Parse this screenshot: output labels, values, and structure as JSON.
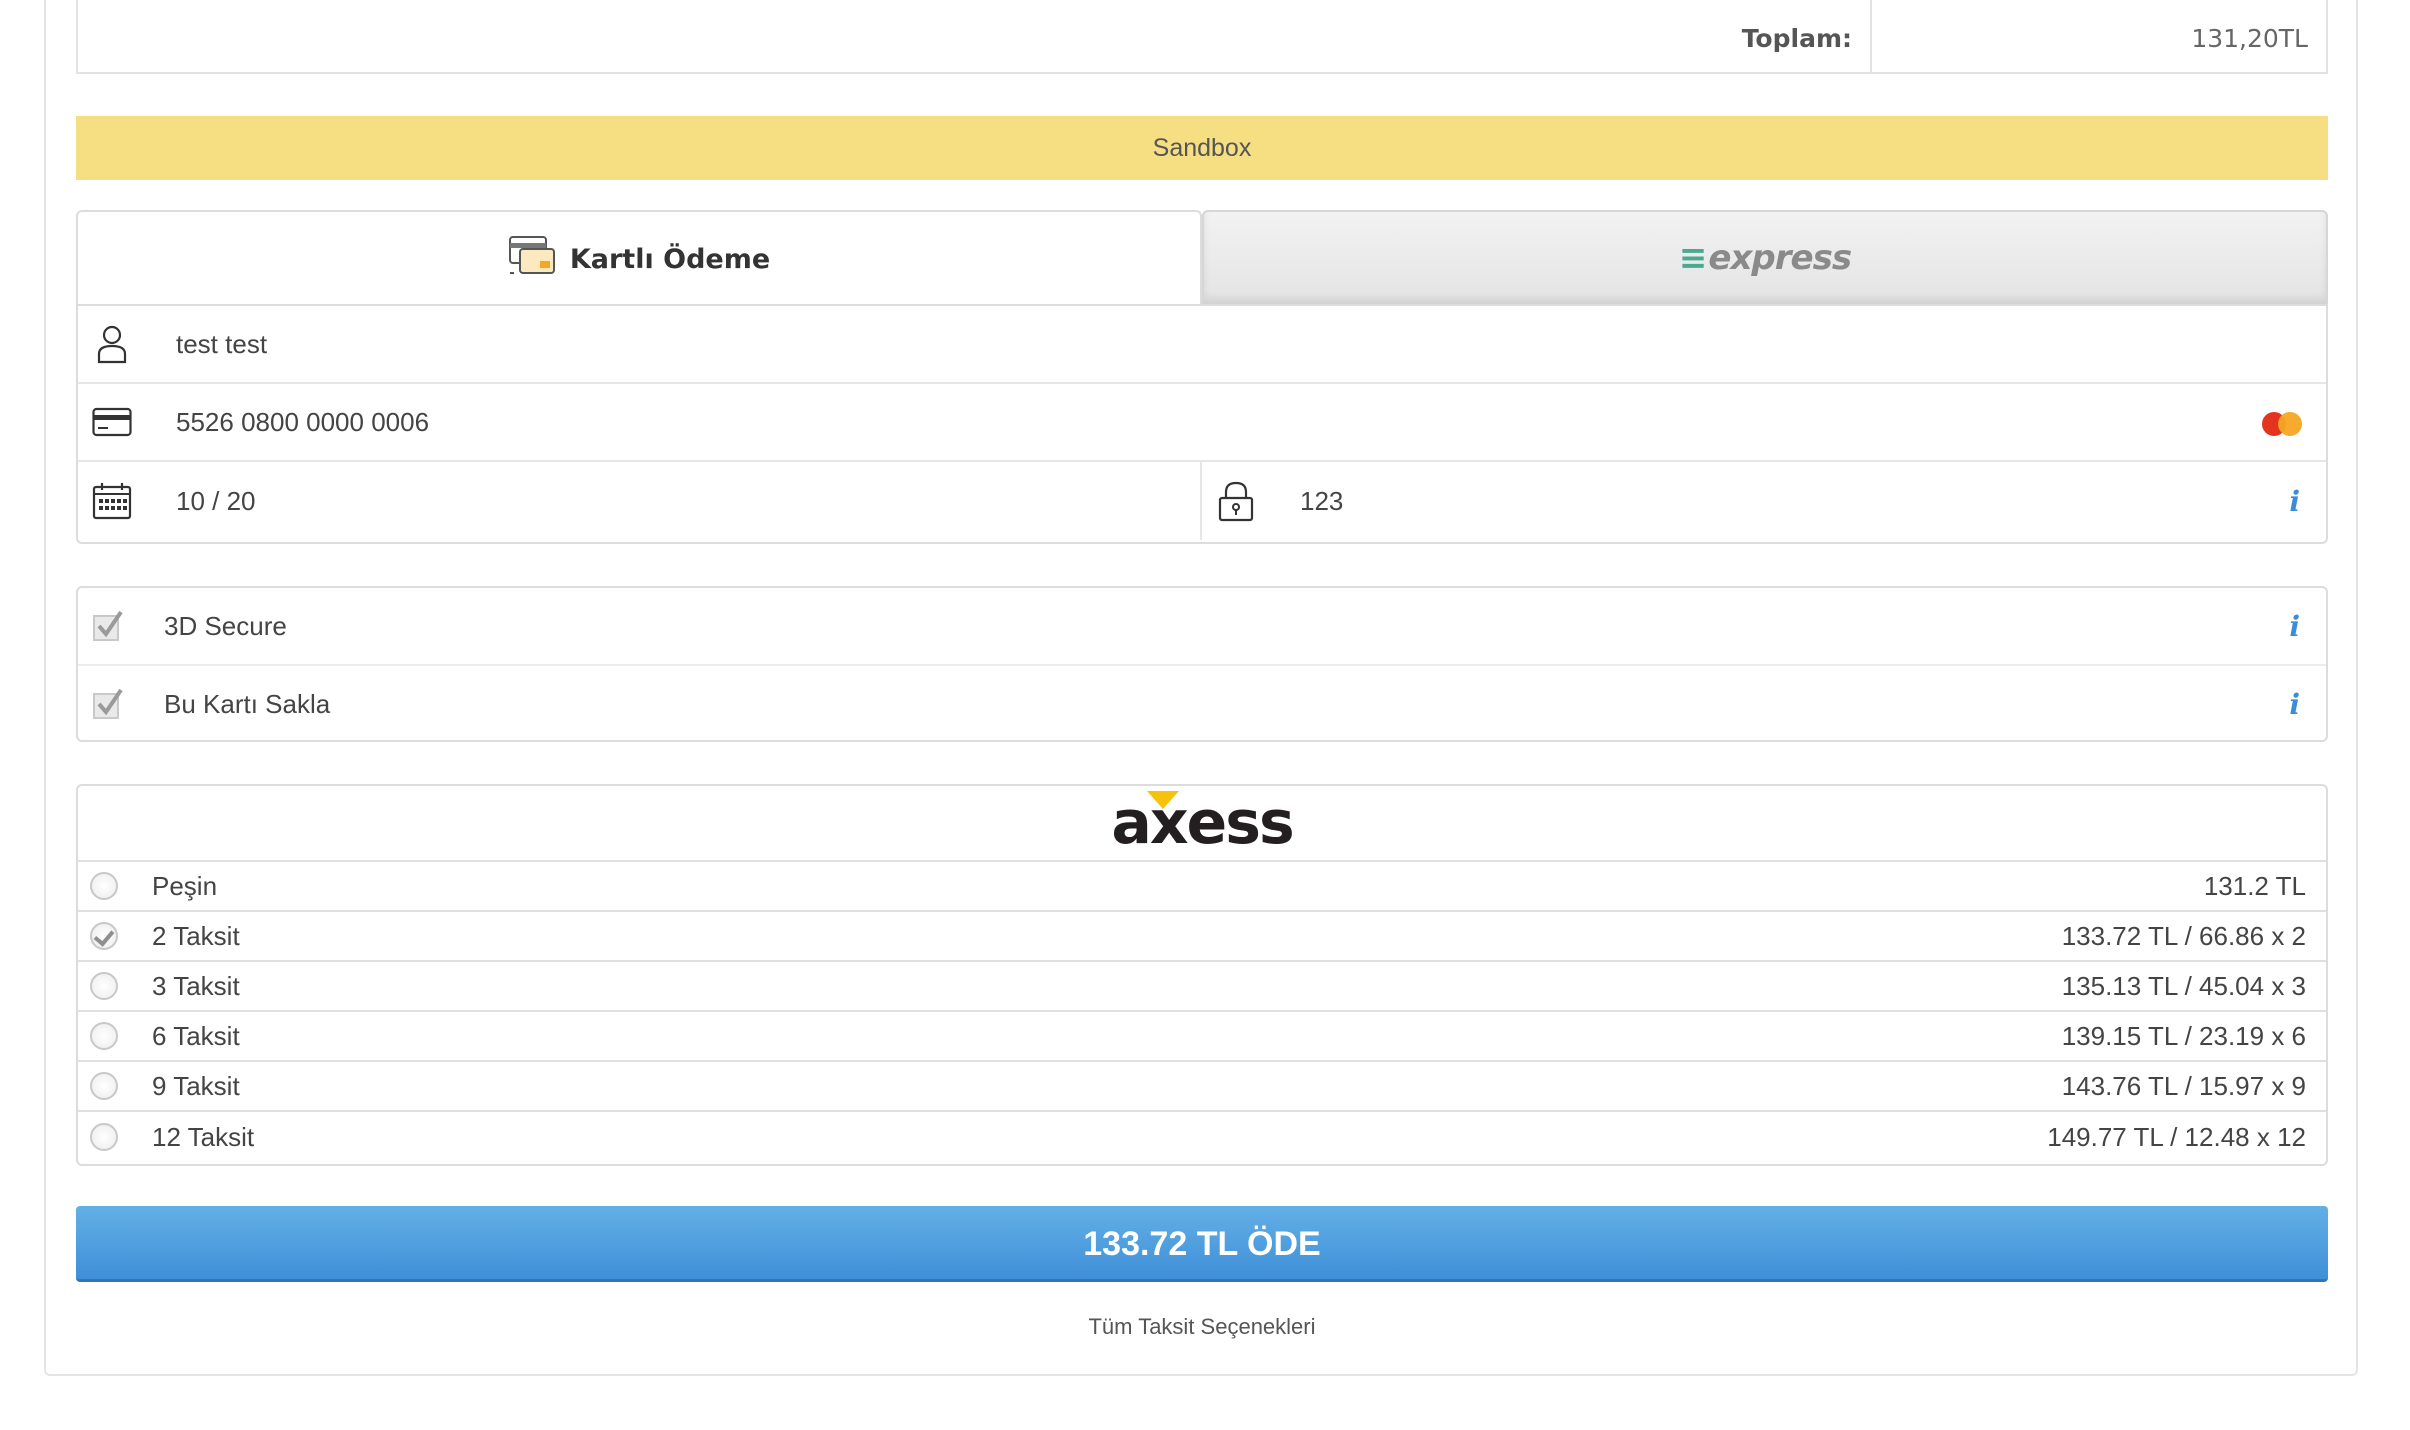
{
  "summary": {
    "total_label": "Toplam:",
    "total_value": "131,20TL"
  },
  "sandbox": {
    "label": "Sandbox"
  },
  "tabs": {
    "card_label": "Kartlı Ödeme",
    "express_label": "express"
  },
  "card_form": {
    "name": "test test",
    "card_number": "5526 0800 0000 0006",
    "expiry": "10 / 20",
    "cvv": "123"
  },
  "options": {
    "secure_label": "3D Secure",
    "save_label": "Bu Kartı Sakla"
  },
  "installments": {
    "bank": "axess",
    "rows": [
      {
        "label": "Peşin",
        "amount": "131.2 TL",
        "selected": false
      },
      {
        "label": "2 Taksit",
        "amount": "133.72 TL / 66.86 x 2",
        "selected": true
      },
      {
        "label": "3 Taksit",
        "amount": "135.13 TL / 45.04 x 3",
        "selected": false
      },
      {
        "label": "6 Taksit",
        "amount": "139.15 TL / 23.19 x 6",
        "selected": false
      },
      {
        "label": "9 Taksit",
        "amount": "143.76 TL / 15.97 x 9",
        "selected": false
      },
      {
        "label": "12 Taksit",
        "amount": "149.77 TL / 12.48 x 12",
        "selected": false
      }
    ]
  },
  "pay_button": {
    "label": "133.72 TL ÖDE"
  },
  "all_options_link": {
    "label": "Tüm Taksit Seçenekleri"
  },
  "colors": {
    "sandbox_bg": "#f6de82",
    "accent_blue": "#3f8fd8",
    "card_brand_red": "#e4331e",
    "card_brand_orange": "#f5a623"
  },
  "icons": [
    "card-payment-icon",
    "user-icon",
    "credit-card-icon",
    "mastercard-icon",
    "calendar-icon",
    "lock-icon",
    "info-icon",
    "checkbox-checked-icon"
  ]
}
